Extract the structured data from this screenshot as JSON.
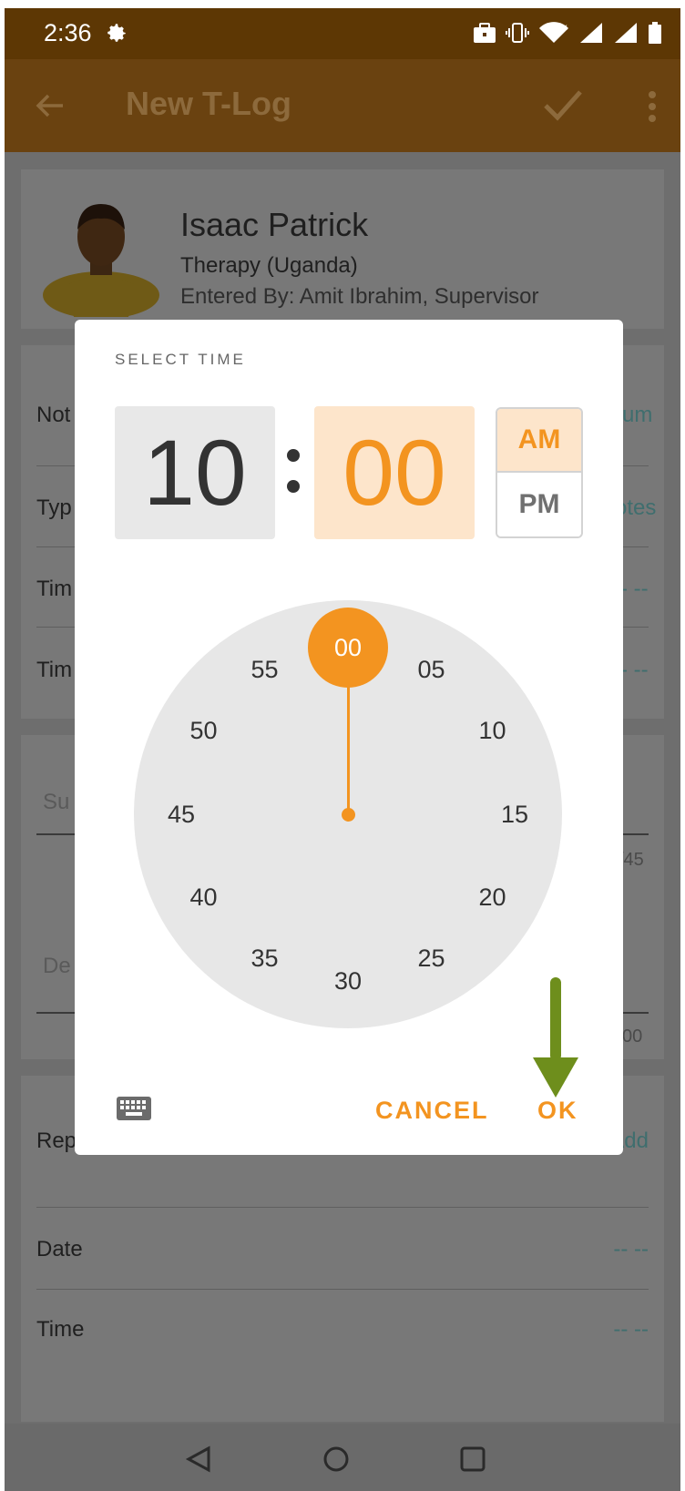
{
  "status_bar": {
    "time": "2:36"
  },
  "app_bar": {
    "title": "New T-Log"
  },
  "profile": {
    "name": "Isaac Patrick",
    "program": "Therapy (Uganda)",
    "entered_by": "Entered By: Amit Ibrahim, Supervisor"
  },
  "form": {
    "notes_label_partial": "Not",
    "notes_value_partial": "um",
    "type_label_partial": "Typ",
    "type_value_partial": "otes",
    "time1_label_partial": "Tim",
    "time1_value_partial": "-- --",
    "time2_label_partial": "Tim",
    "time2_value_partial": "-- --",
    "subject_hint_partial": "Su",
    "subject_counter_partial": "/45",
    "description_hint_partial": "De",
    "description_counter_partial": "00",
    "reporter_label": "Reporter",
    "reporter_action": "Add",
    "date_label": "Date",
    "date_value": "-- --",
    "time_label": "Time",
    "time_value": "-- --"
  },
  "time_picker": {
    "header": "SELECT TIME",
    "hour": "10",
    "minute": "00",
    "am_label": "AM",
    "pm_label": "PM",
    "selected_period": "AM",
    "clock_numbers": [
      "00",
      "05",
      "10",
      "15",
      "20",
      "25",
      "30",
      "35",
      "40",
      "45",
      "50",
      "55"
    ],
    "selected_minute": "00",
    "cancel_label": "CANCEL",
    "ok_label": "OK"
  },
  "colors": {
    "accent": "#f39420",
    "annotation_arrow": "#6e8e1c"
  }
}
